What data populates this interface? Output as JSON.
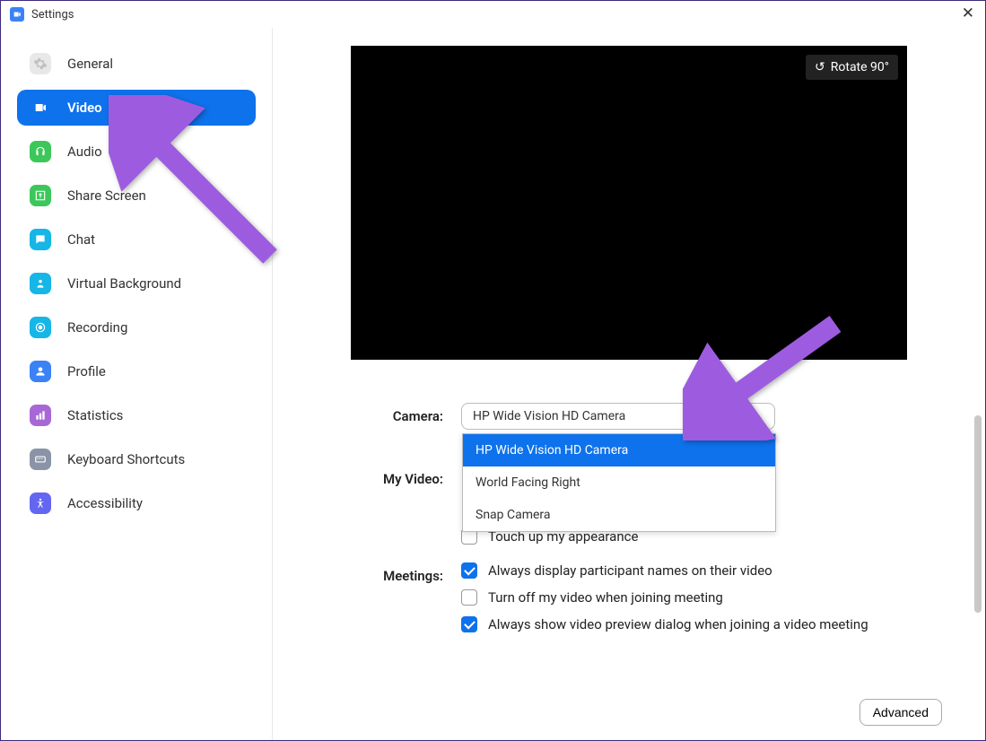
{
  "window": {
    "title": "Settings"
  },
  "sidebar": {
    "items": [
      {
        "label": "General",
        "icon": "gear-icon",
        "iconBg": "#e8e8e8"
      },
      {
        "label": "Video",
        "icon": "video-icon",
        "iconBg": "#ffffff",
        "active": true
      },
      {
        "label": "Audio",
        "icon": "headphones-icon",
        "iconBg": "#3cc75a"
      },
      {
        "label": "Share Screen",
        "icon": "share-icon",
        "iconBg": "#3cc75a"
      },
      {
        "label": "Chat",
        "icon": "chat-icon",
        "iconBg": "#16b6e6"
      },
      {
        "label": "Virtual Background",
        "icon": "virtualbg-icon",
        "iconBg": "#16b6e6"
      },
      {
        "label": "Recording",
        "icon": "record-icon",
        "iconBg": "#16b6e6"
      },
      {
        "label": "Profile",
        "icon": "profile-icon",
        "iconBg": "#3b82f6"
      },
      {
        "label": "Statistics",
        "icon": "stats-icon",
        "iconBg": "#a768d6"
      },
      {
        "label": "Keyboard Shortcuts",
        "icon": "keyboard-icon",
        "iconBg": "#8a94a6"
      },
      {
        "label": "Accessibility",
        "icon": "accessibility-icon",
        "iconBg": "#6366f1"
      }
    ]
  },
  "main": {
    "rotate_label": "Rotate 90°",
    "camera_label": "Camera:",
    "camera_selected": "HP Wide Vision HD Camera",
    "camera_options": [
      "HP Wide Vision HD Camera",
      "World Facing Right",
      "Snap Camera"
    ],
    "myvideo_label": "My Video:",
    "meetings_label": "Meetings:",
    "checkboxes": {
      "touchup": {
        "label": "Touch up my appearance",
        "checked": false
      },
      "displaynames": {
        "label": "Always display participant names on their video",
        "checked": true
      },
      "turnoff": {
        "label": "Turn off my video when joining meeting",
        "checked": false
      },
      "previewdialog": {
        "label": "Always show video preview dialog when joining a video meeting",
        "checked": true
      }
    },
    "advanced_label": "Advanced"
  }
}
